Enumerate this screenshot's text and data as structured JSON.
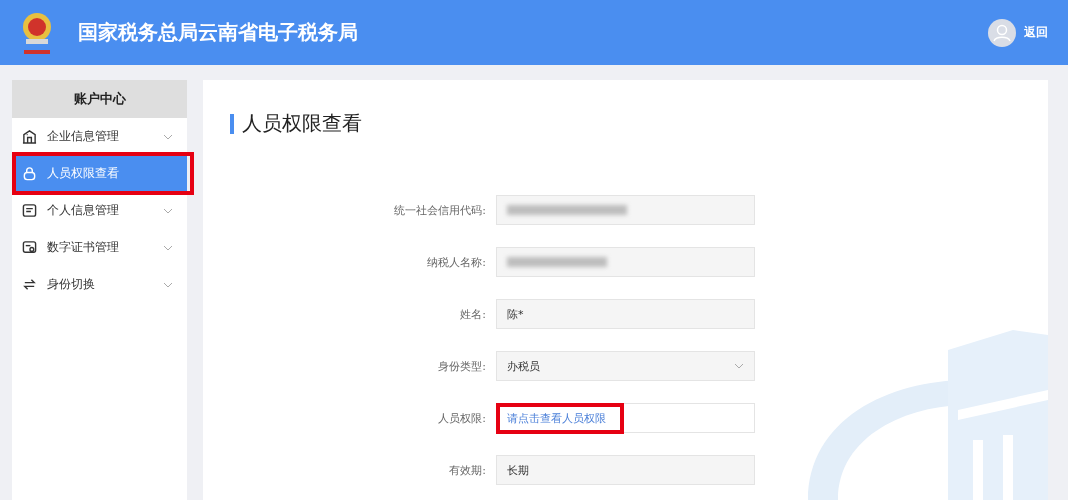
{
  "header": {
    "title": "国家税务总局云南省电子税务局",
    "back_link": "返回"
  },
  "sidebar": {
    "title": "账户中心",
    "items": [
      {
        "label": "企业信息管理",
        "expandable": true,
        "selected": false,
        "highlighted": false
      },
      {
        "label": "人员权限查看",
        "expandable": false,
        "selected": true,
        "highlighted": true
      },
      {
        "label": "个人信息管理",
        "expandable": true,
        "selected": false,
        "highlighted": false
      },
      {
        "label": "数字证书管理",
        "expandable": true,
        "selected": false,
        "highlighted": false
      },
      {
        "label": "身份切换",
        "expandable": true,
        "selected": false,
        "highlighted": false
      }
    ]
  },
  "page": {
    "title": "人员权限查看",
    "fields": [
      {
        "label": "统一社会信用代码:",
        "kind": "blurred"
      },
      {
        "label": "纳税人名称:",
        "kind": "blurred"
      },
      {
        "label": "姓名:",
        "kind": "text",
        "value": "陈*"
      },
      {
        "label": "身份类型:",
        "kind": "select",
        "value": "办税员"
      },
      {
        "label": "人员权限:",
        "kind": "link",
        "value": "请点击查看人员权限",
        "highlighted": true
      },
      {
        "label": "有效期:",
        "kind": "text",
        "value": "长期"
      }
    ]
  }
}
